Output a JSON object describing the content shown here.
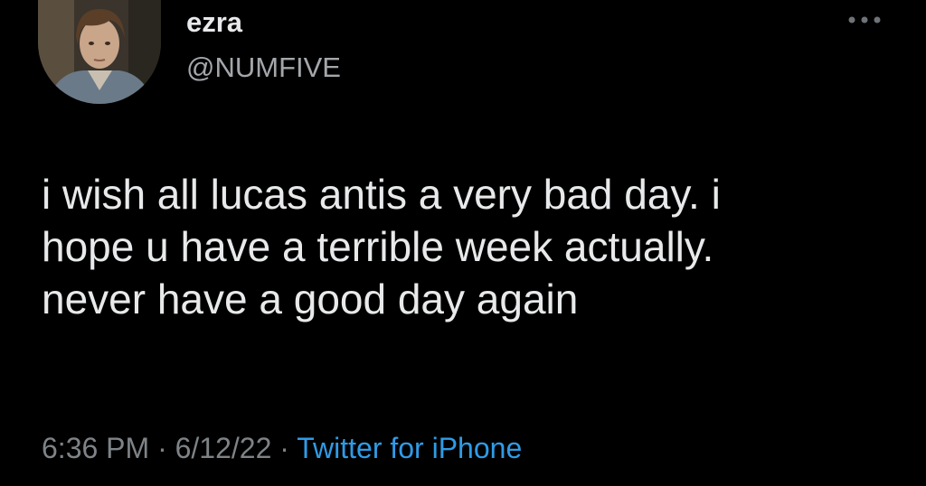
{
  "user": {
    "display_name": "ezra",
    "handle": "@NUMFIVE",
    "avatar_icon": "profile-photo"
  },
  "tweet": {
    "lines": [
      "i wish all lucas antis a very bad day. i",
      "hope u have a terrible week actually.",
      "never have a good day again"
    ],
    "time": "6:36 PM",
    "separator": "·",
    "date": "6/12/22",
    "source": "Twitter for iPhone"
  },
  "icons": {
    "more": "more-options-icon"
  },
  "colors": {
    "background": "#000000",
    "text": "#e7e9ea",
    "secondary_text": "#7e8387",
    "link": "#2f9be6"
  }
}
